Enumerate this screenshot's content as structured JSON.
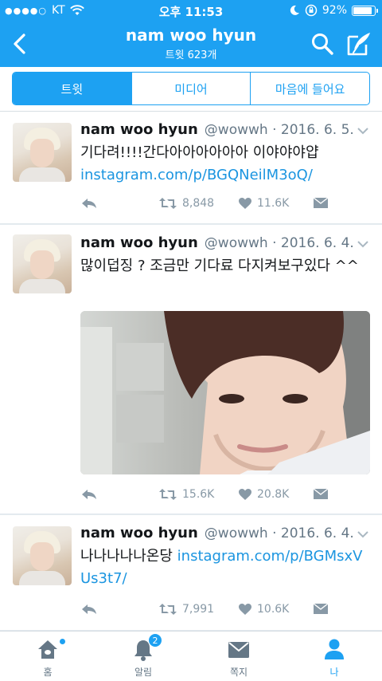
{
  "status_bar": {
    "signal": "●●●●○",
    "carrier": "KT",
    "time": "오후 11:53",
    "battery_percent": "92%",
    "battery_level": 0.92
  },
  "nav": {
    "title": "nam woo hyun",
    "subtitle": "트윗 623개"
  },
  "segments": [
    {
      "label": "트윗",
      "active": true
    },
    {
      "label": "미디어",
      "active": false
    },
    {
      "label": "마음에 들어요",
      "active": false
    }
  ],
  "tweets": [
    {
      "name": "nam woo hyun",
      "handle": "@wowwh · 2016. 6. 5.",
      "text": "기다려!!!!간다아아아아아아 이야야야얍",
      "link": "instagram.com/p/BGQNeilM3oQ/",
      "retweets": "8,848",
      "likes": "11.6K"
    },
    {
      "name": "nam woo hyun",
      "handle": "@wowwh · 2016. 6. 4.",
      "text": "많이덥징 ? 조금만 기다료 다지켜보구있다 ^^",
      "link": "",
      "retweets": "15.6K",
      "likes": "20.8K"
    },
    {
      "name": "nam woo hyun",
      "handle": "@wowwh · 2016. 6. 4.",
      "text": "나나나나나온당 ",
      "link": "instagram.com/p/BGMsxVUs3t7/",
      "retweets": "7,991",
      "likes": "10.6K"
    }
  ],
  "tab_bar": [
    {
      "label": "홈",
      "icon": "home-icon"
    },
    {
      "label": "알림",
      "icon": "bell-icon",
      "badge": "2"
    },
    {
      "label": "쪽지",
      "icon": "envelope-icon"
    },
    {
      "label": "나",
      "icon": "person-icon",
      "active": true
    }
  ],
  "colors": {
    "accent": "#1da1f2",
    "link": "#1b95e0",
    "muted": "#8899a6"
  }
}
